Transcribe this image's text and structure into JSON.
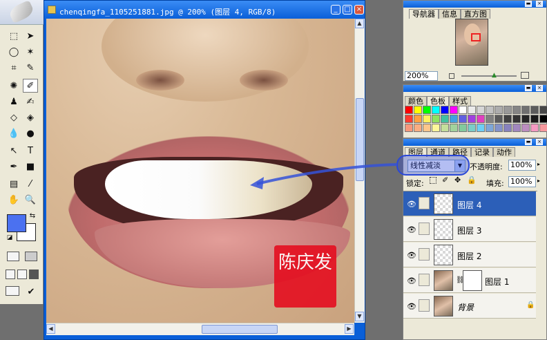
{
  "document": {
    "title": "chenqingfa_1105251881.jpg @ 200% (图层 4, RGB/8)",
    "min_glyph": "_",
    "max_glyph": "□",
    "close_glyph": "×",
    "stamp_text": "陈庆发"
  },
  "navigator": {
    "tabs": [
      "导航器",
      "信息",
      "直方图"
    ],
    "zoom": "200%"
  },
  "color_panel": {
    "tabs": [
      "颜色",
      "色板",
      "样式"
    ],
    "swatches": [
      "#ff0000",
      "#ffff00",
      "#00ff00",
      "#00ffff",
      "#0000ff",
      "#ff00ff",
      "#ffffff",
      "#ebebeb",
      "#d6d6d6",
      "#c2c2c2",
      "#adadad",
      "#999999",
      "#858585",
      "#707070",
      "#5c5c5c",
      "#474747",
      "#ff3b2f",
      "#ffa040",
      "#fff060",
      "#90e060",
      "#40c0a0",
      "#40a0e0",
      "#6060e0",
      "#a040e0",
      "#e040c0",
      "#808080",
      "#5a5a5a",
      "#404040",
      "#333333",
      "#262626",
      "#1a1a1a",
      "#000000",
      "#f7977a",
      "#f9ad81",
      "#fdc68a",
      "#fff79a",
      "#c4df9b",
      "#a2d39c",
      "#82ca9d",
      "#7bcdc8",
      "#6ecff6",
      "#7ea7d8",
      "#8493ca",
      "#8882be",
      "#a187be",
      "#bc8dbf",
      "#f49ac2",
      "#f6989d"
    ]
  },
  "layers_panel": {
    "tabs": [
      "图层",
      "通道",
      "路径",
      "记录",
      "动作"
    ],
    "blend_mode": "线性减淡",
    "opacity_label": "不透明度:",
    "opacity": "100%",
    "lock_label": "锁定:",
    "fill_label": "填充:",
    "fill": "100%",
    "layers": [
      {
        "name": "图层 4",
        "selected": true
      },
      {
        "name": "图层 3",
        "selected": false
      },
      {
        "name": "图层 2",
        "selected": false
      },
      {
        "name": "图层 1",
        "selected": false
      },
      {
        "name": "背景",
        "selected": false
      }
    ]
  },
  "colors": {
    "foreground": "#4b71f0",
    "background": "#ffffff",
    "title_bar": "#0a5fd8",
    "selected_layer": "#2c5fb8"
  }
}
